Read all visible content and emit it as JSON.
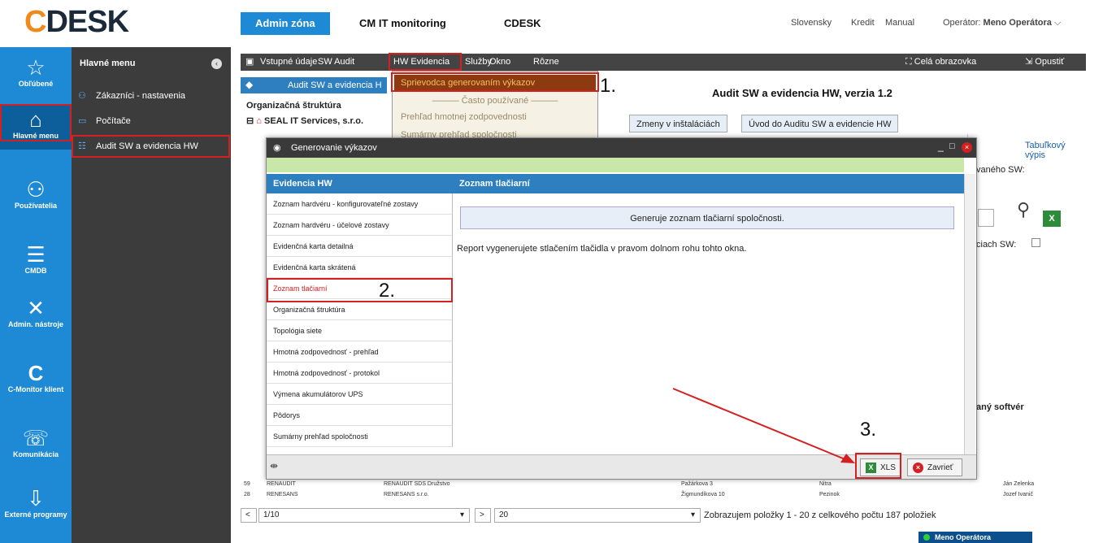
{
  "logo": {
    "c": "C",
    "rest": "DESK"
  },
  "top_tabs": [
    "Admin zóna",
    "CM IT monitoring",
    "CDESK"
  ],
  "top_links": {
    "lang": "Slovensky",
    "credit": "Kredit",
    "manual": "Manual",
    "operator_label": "Operátor:",
    "operator_name": "Meno Operátora"
  },
  "iconbar": [
    {
      "label": "Obľúbené",
      "icon": "star-icon"
    },
    {
      "label": "Hlavné menu",
      "icon": "home-icon"
    },
    {
      "label": "Používatelia",
      "icon": "users-icon"
    },
    {
      "label": "CMDB",
      "icon": "database-icon"
    },
    {
      "label": "Admin. nástroje",
      "icon": "tools-icon"
    },
    {
      "label": "C-Monitor klient",
      "icon": "c-monitor-icon"
    },
    {
      "label": "Komunikácia",
      "icon": "communication-icon"
    },
    {
      "label": "Externé programy",
      "icon": "external-icon"
    }
  ],
  "mainmenu": {
    "title": "Hlavné menu",
    "items": [
      "Zákazníci - nastavenia",
      "Počítače",
      "Audit SW a evidencia HW"
    ]
  },
  "appbar": {
    "items": [
      "Vstupné údaje",
      "SW Audit",
      "HW Evidencia",
      "Služby",
      "Okno",
      "Rôzne"
    ],
    "fullscreen": "Celá obrazovka",
    "exit": "Opustiť"
  },
  "app": {
    "header_tab": "Audit SW a evidencia H",
    "title": "Audit SW a evidencia HW, verzia 1.2",
    "org_label": "Organizačná štruktúra",
    "org_root": "SEAL IT Services, s.r.o.",
    "tabs": [
      "Zmeny v inštaláciách",
      "Úvod do Auditu SW a evidencie HW"
    ],
    "side": {
      "link": "Tabuľkový výpis",
      "t1": "vaného SW:",
      "t2": "ciach SW:",
      "t3": "aný softvér"
    }
  },
  "dropdown": {
    "highlighted": "Sprievodca generovaním výkazov",
    "separator": "Často používané",
    "items": [
      "Prehľad hmotnej zodpovednosti",
      "Sumárny prehľad spoločnosti"
    ]
  },
  "dialog": {
    "title": "Generovanie výkazov",
    "left_header": "Evidencia HW",
    "right_header": "Zoznam tlačiarní",
    "reports": [
      "Zoznam hardvéru - konfigurovateľné zostavy",
      "Zoznam hardvéru - účelové zostavy",
      "Evidenčná karta detailná",
      "Evidenčná karta skrátená",
      "Zoznam tlačiarní",
      "Organizačná štruktúra",
      "Topológia siete",
      "Hmotná zodpovednosť - prehľad",
      "Hmotná zodpovednosť - protokol",
      "Výmena akumulátorov UPS",
      "Pôdorys",
      "Sumárny prehľad spoločnosti"
    ],
    "description": "Generuje zoznam tlačiarní spoločnosti.",
    "instruction": "Report vygenerujete stlačením tlačidla v pravom dolnom rohu tohto okna.",
    "xls_label": "XLS",
    "close_label": "Zavrieť"
  },
  "steps": [
    "1.",
    "2.",
    "3."
  ],
  "table_rows": [
    [
      "59",
      "RENAUDIT",
      "RENAUDIT SDS Družstvo",
      "Pažárkova 3",
      "Nitra",
      "Ján Zelenka"
    ],
    [
      "28",
      "RENESANS",
      "RENESANS s.r.o.",
      "Žigmundíkova 10",
      "Pezinok",
      "Jozef Ivanič"
    ]
  ],
  "pager": {
    "page": "1/10",
    "size": "20",
    "summary": "Zobrazujem položky 1 - 20 z celkového počtu 187 položiek"
  },
  "status_operator": "Meno Operátora",
  "colors": {
    "accent": "#1e8ad6",
    "dark": "#3c3c3c",
    "highlight": "#d42020"
  }
}
